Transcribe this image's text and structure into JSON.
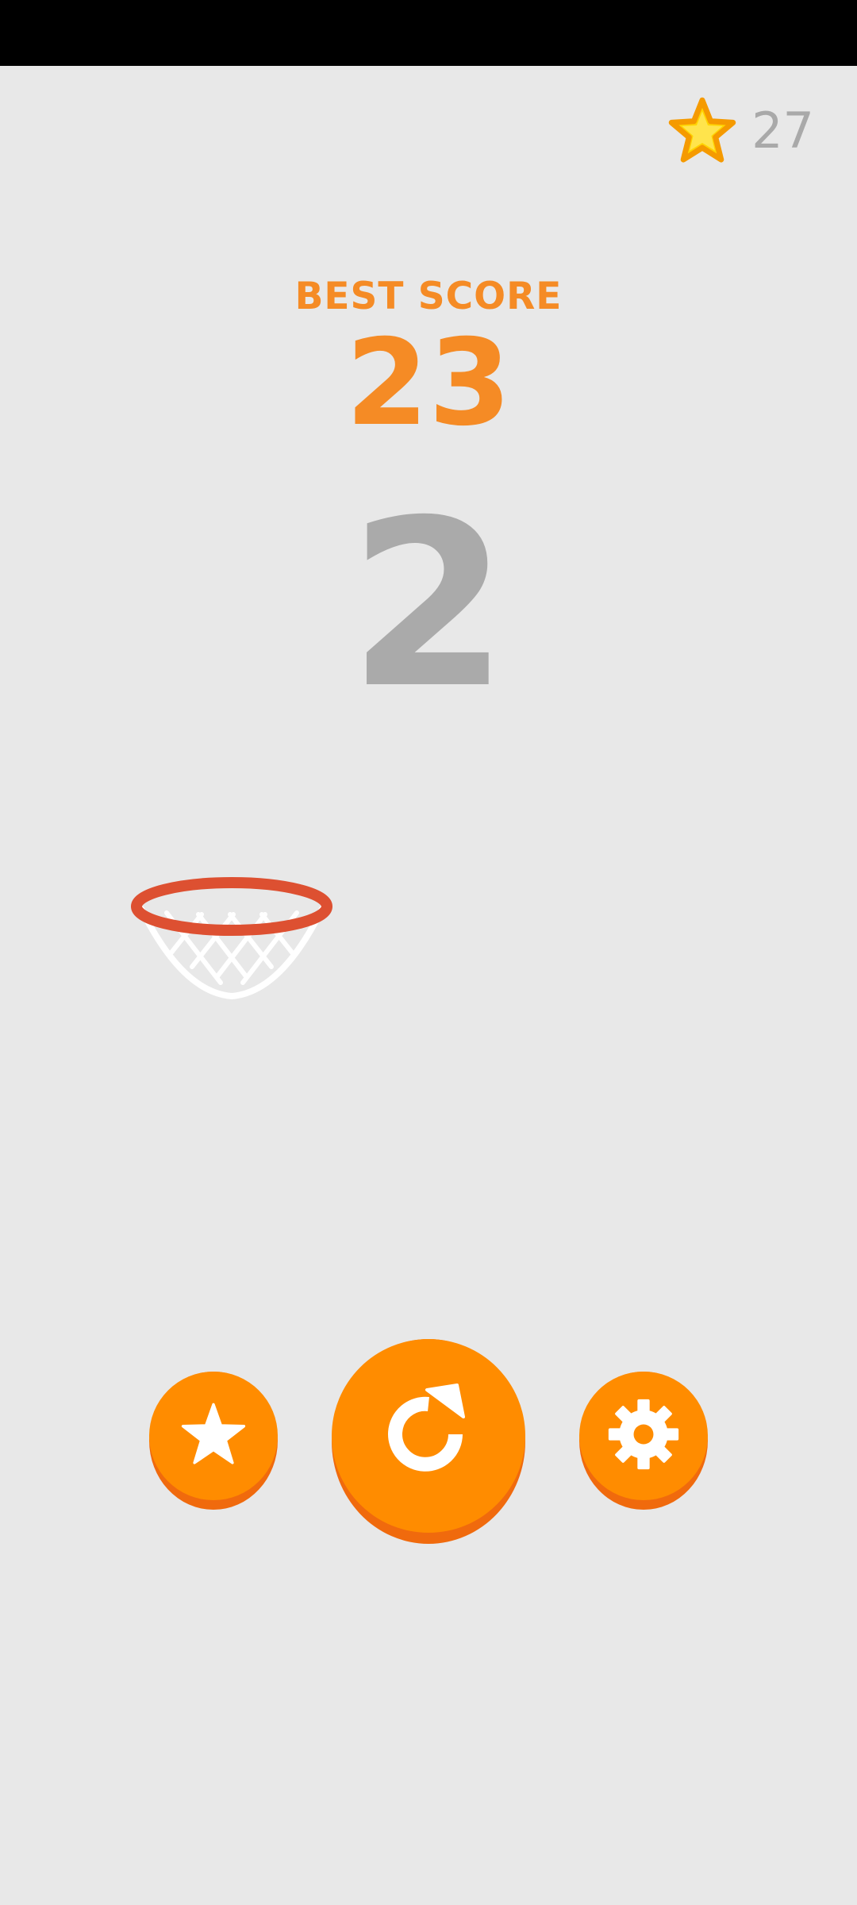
{
  "header": {
    "star_icon": "star-icon",
    "star_count": "27"
  },
  "score": {
    "best_label": "BEST SCORE",
    "best_value": "23",
    "current_value": "2"
  },
  "hoop": {
    "icon": "basketball-hoop-icon"
  },
  "buttons": {
    "favorites_icon": "star-icon",
    "replay_icon": "replay-icon",
    "settings_icon": "gear-icon"
  },
  "colors": {
    "background": "#e8e8e8",
    "accent": "#ff8c00",
    "accent_shadow": "#f06a0d",
    "best_score": "#f58b25",
    "current_score": "#aaaaaa",
    "rim": "#dd5031",
    "net": "#ffffff",
    "star_fill": "#ffd400",
    "star_outline": "#f59a00"
  }
}
